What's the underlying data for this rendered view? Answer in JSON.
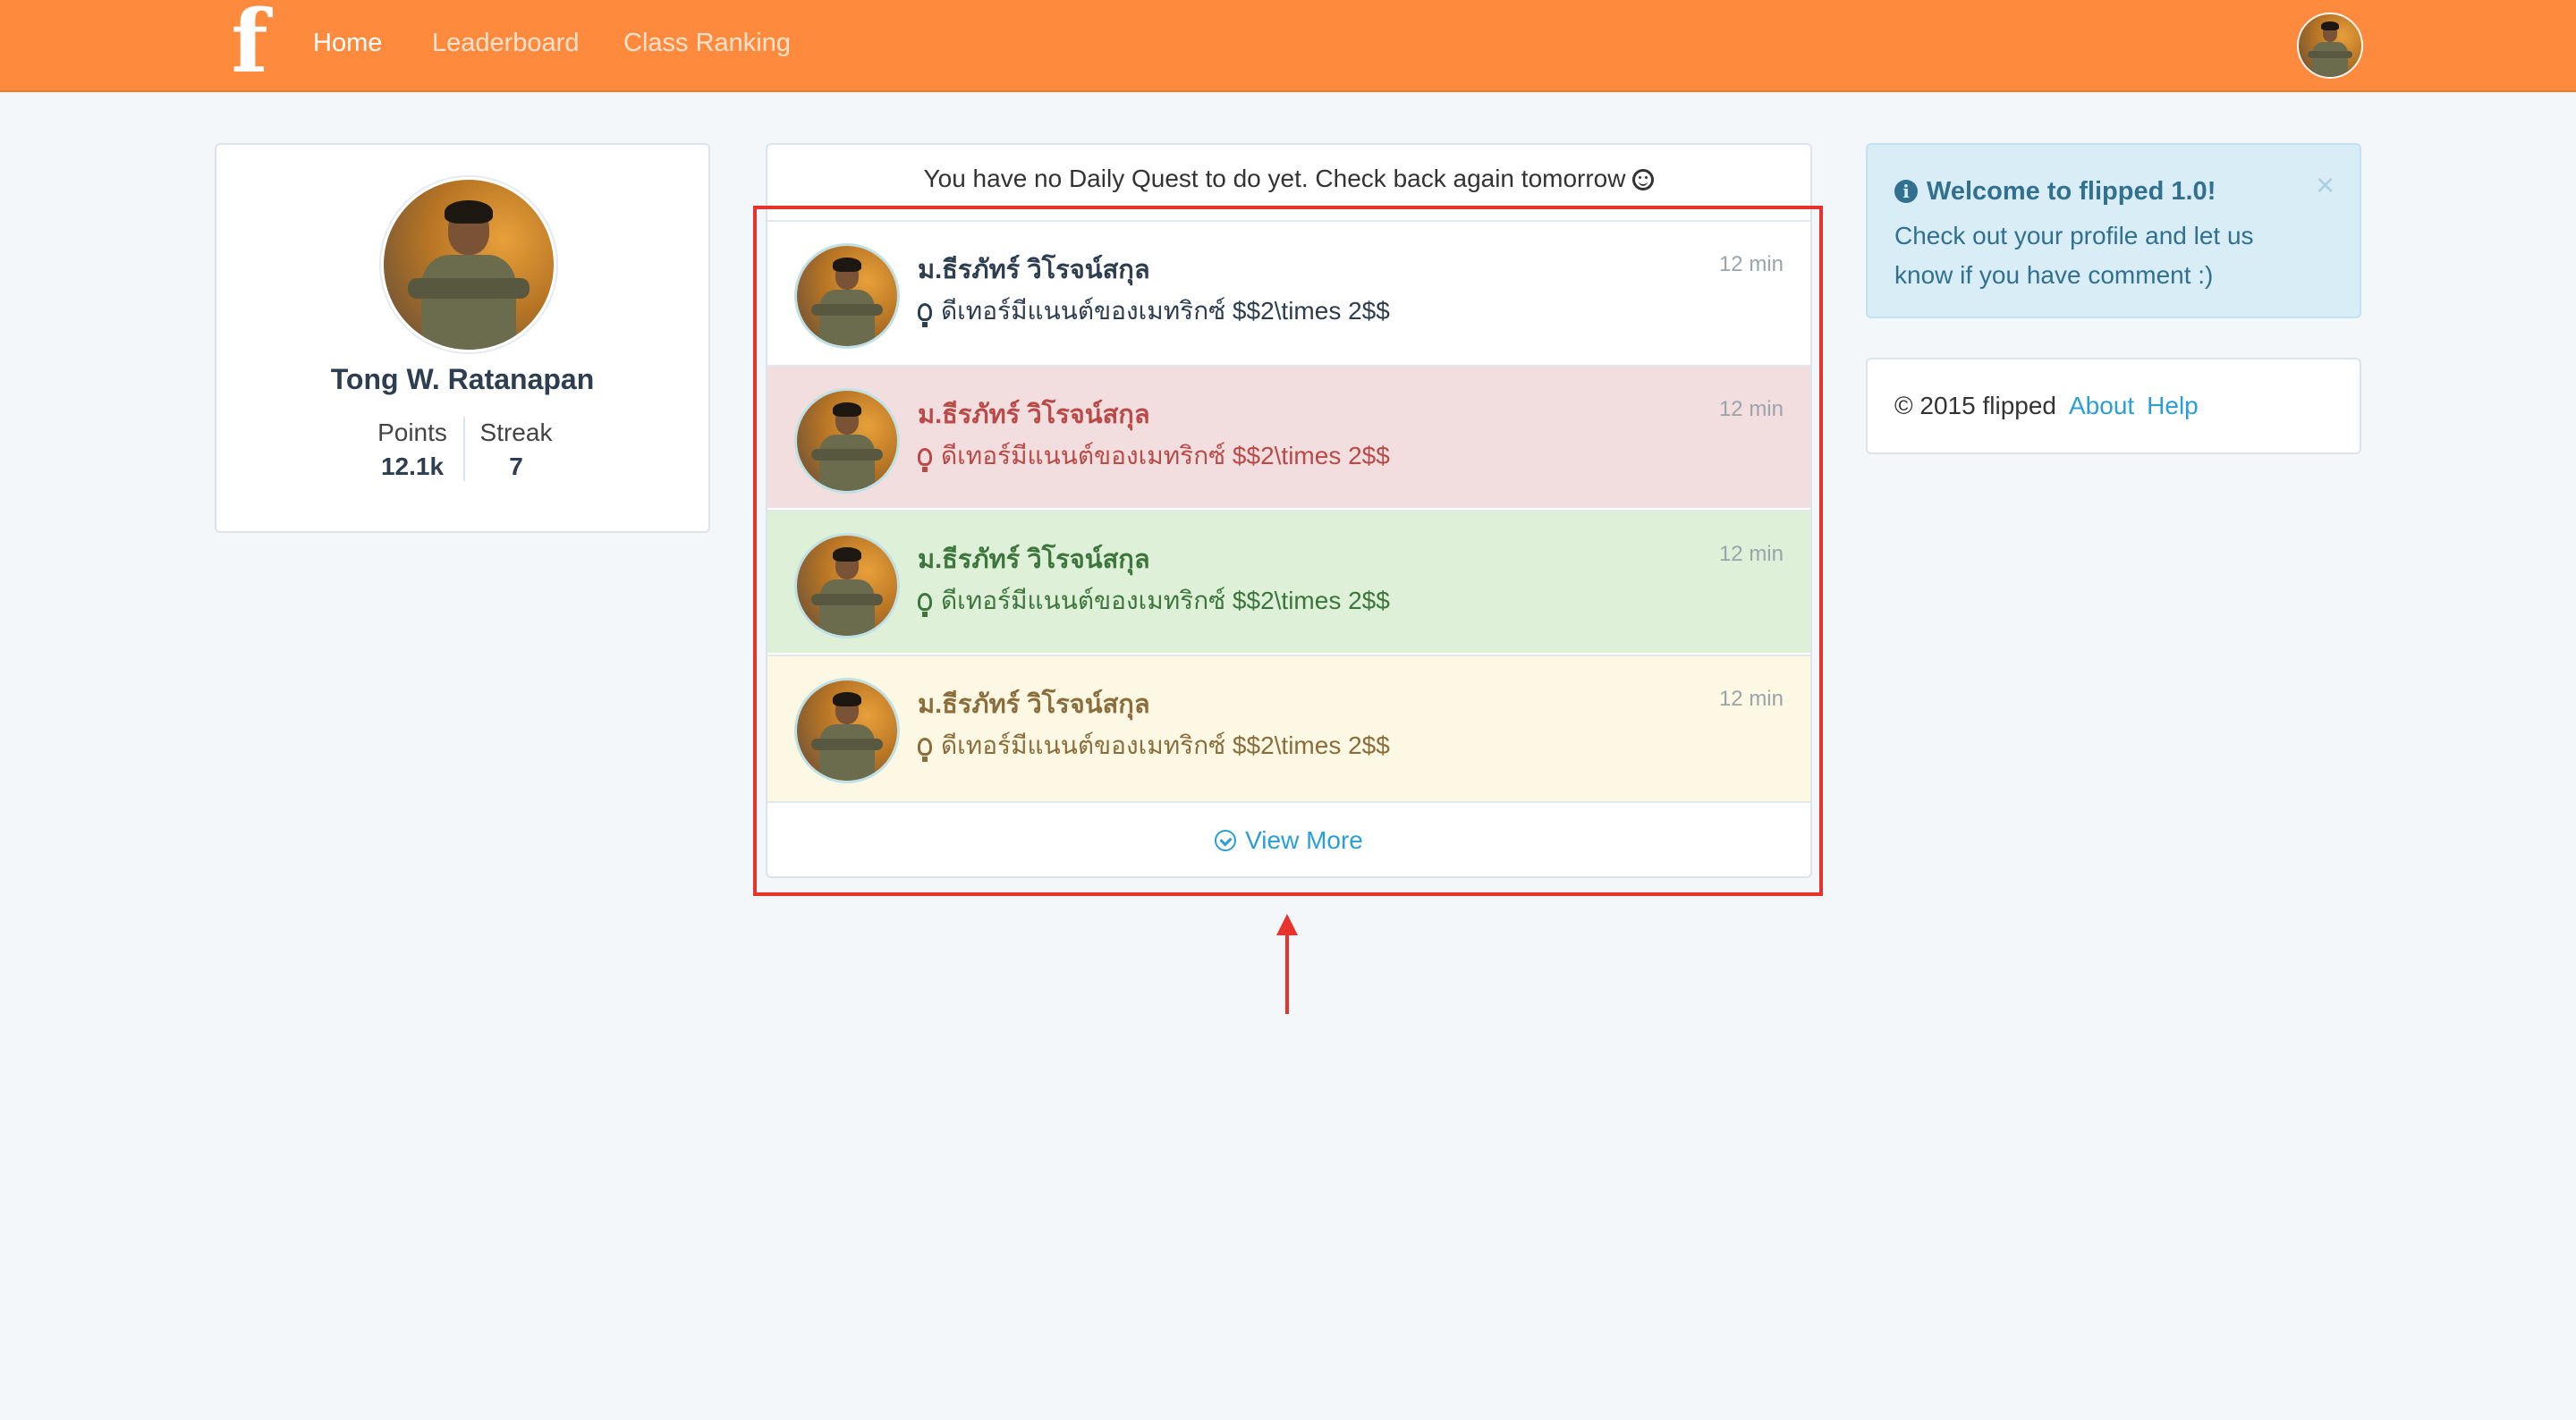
{
  "nav": {
    "logo": "f",
    "links": [
      "Home",
      "Leaderboard",
      "Class Ranking"
    ]
  },
  "profile": {
    "name": "Tong W. Ratanapan",
    "points_label": "Points",
    "points_value": "12.1k",
    "streak_label": "Streak",
    "streak_value": "7"
  },
  "feed": {
    "notice": "You have no Daily Quest to do yet. Check back again tomorrow",
    "items": [
      {
        "author": "ม.ธีรภัทร์ วิโรจน์สกุล",
        "text": "ดีเทอร์มีแนนต์ของเมทริกซ์ $$2\\times 2$$",
        "time": "12 min",
        "variant": "default"
      },
      {
        "author": "ม.ธีรภัทร์ วิโรจน์สกุล",
        "text": "ดีเทอร์มีแนนต์ของเมทริกซ์ $$2\\times 2$$",
        "time": "12 min",
        "variant": "danger"
      },
      {
        "author": "ม.ธีรภัทร์ วิโรจน์สกุล",
        "text": "ดีเทอร์มีแนนต์ของเมทริกซ์ $$2\\times 2$$",
        "time": "12 min",
        "variant": "success"
      },
      {
        "author": "ม.ธีรภัทร์ วิโรจน์สกุล",
        "text": "ดีเทอร์มีแนนต์ของเมทริกซ์ $$2\\times 2$$",
        "time": "12 min",
        "variant": "warning"
      }
    ],
    "view_more": "View More"
  },
  "alert": {
    "title": "Welcome to flipped 1.0!",
    "message": "Check out your profile and let us know if you have comment :)",
    "close": "×"
  },
  "footer": {
    "copyright": "© 2015 flipped",
    "about": "About",
    "help": "Help"
  },
  "colors": {
    "brand": "#fd8a3d",
    "link": "#2a9fd6",
    "annotation": "#e8322c"
  }
}
